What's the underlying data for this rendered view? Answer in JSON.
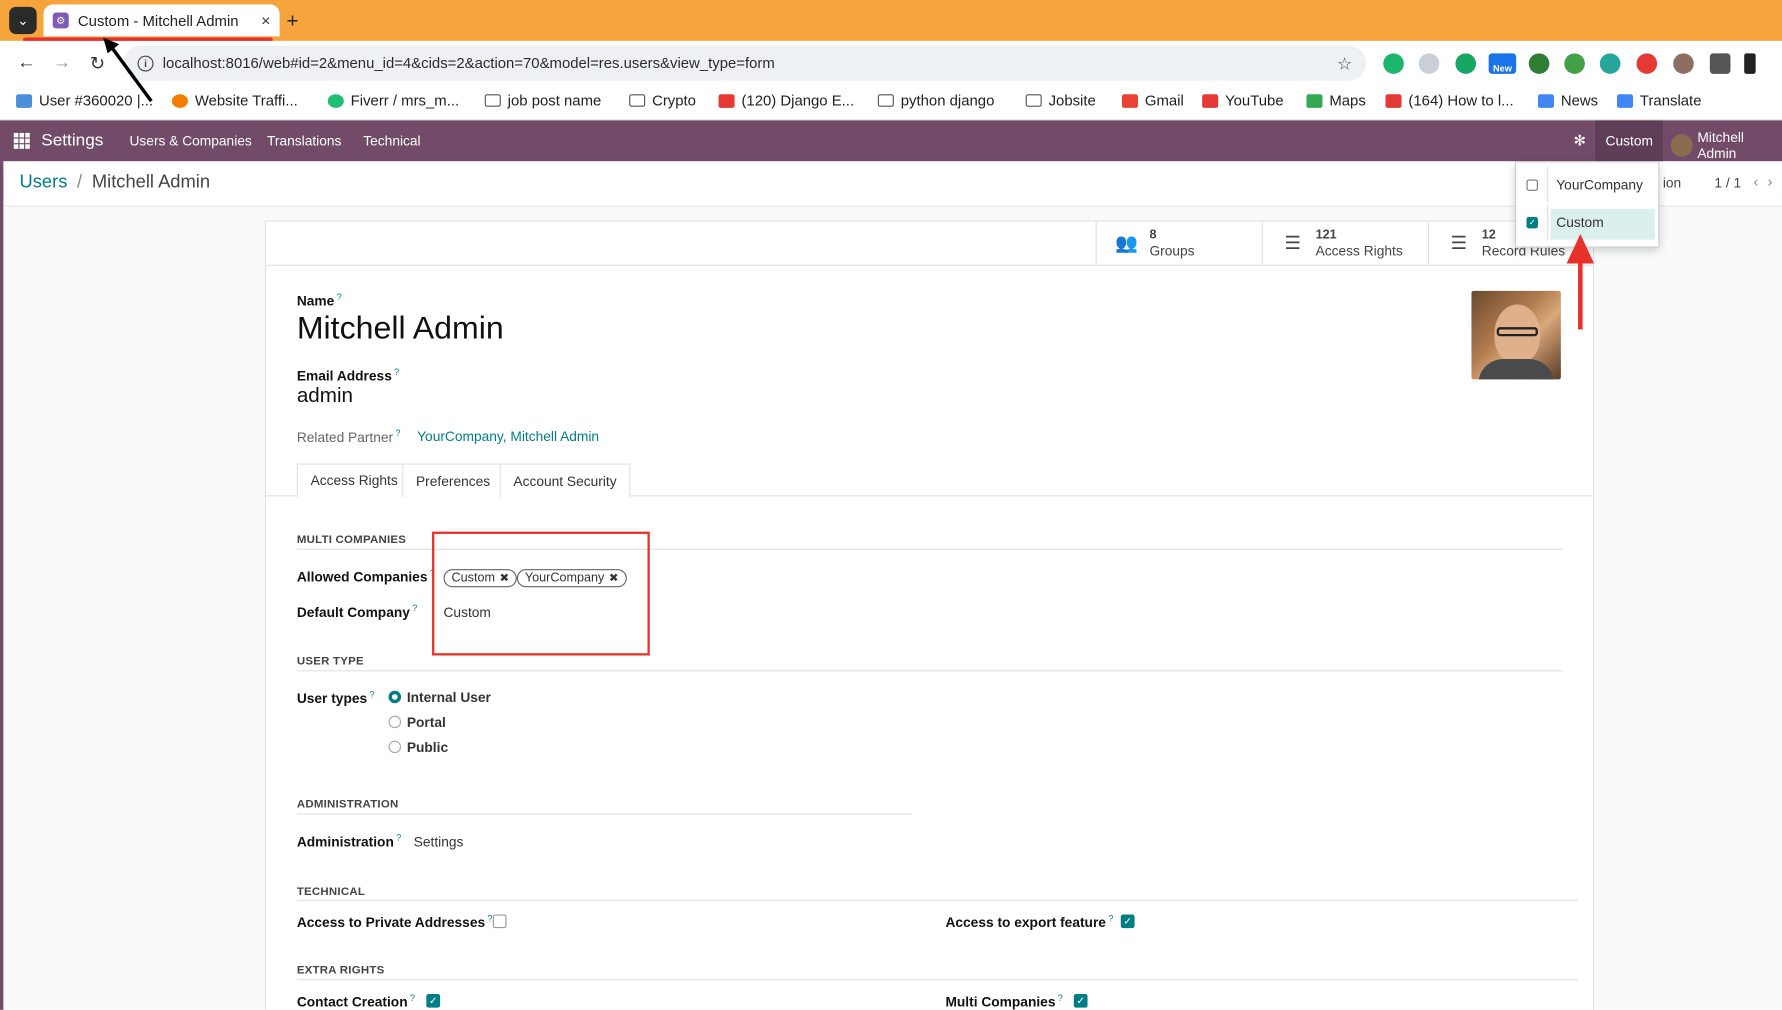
{
  "browser": {
    "tab_title": "Custom - Mitchell Admin",
    "new_tab": "+",
    "close_tab": "×",
    "url": "localhost:8016/web#id=2&menu_id=4&cids=2&action=70&model=res.users&view_type=form",
    "bookmarks": [
      "User #360020 |...",
      "Website Traffi...",
      "Fiverr / mrs_m...",
      "job post name",
      "Crypto",
      "(120) Django E...",
      "python django",
      "Jobsite",
      "Gmail",
      "YouTube",
      "Maps",
      "(164) How to l...",
      "News",
      "Translate"
    ],
    "extension_badge": "New"
  },
  "odoo_nav": {
    "brand": "Settings",
    "menus": [
      "Users & Companies",
      "Translations",
      "Technical"
    ],
    "company": "Custom",
    "user": "Mitchell Admin"
  },
  "company_switcher": {
    "items": [
      {
        "label": "YourCompany",
        "checked": false
      },
      {
        "label": "Custom",
        "checked": true
      }
    ]
  },
  "breadcrumb": {
    "parent": "Users",
    "separator": "/",
    "current": "Mitchell Admin"
  },
  "pager": {
    "hidden_label": "ion",
    "value": "1 / 1"
  },
  "stat_buttons": [
    {
      "value": "8",
      "label": "Groups"
    },
    {
      "value": "121",
      "label": "Access Rights"
    },
    {
      "value": "12",
      "label": "Record Rules"
    }
  ],
  "form": {
    "name_label": "Name",
    "name": "Mitchell Admin",
    "email_label": "Email Address",
    "email": "admin",
    "partner_label": "Related Partner",
    "partner": "YourCompany, Mitchell Admin",
    "help_mark": "?"
  },
  "notebook_tabs": [
    "Access Rights",
    "Preferences",
    "Account Security"
  ],
  "multi_companies": {
    "section": "MULTI COMPANIES",
    "allowed_label": "Allowed Companies",
    "allowed_tags": [
      "Custom",
      "YourCompany"
    ],
    "default_label": "Default Company",
    "default_value": "Custom"
  },
  "user_type": {
    "section": "USER TYPE",
    "label": "User types",
    "options": [
      {
        "label": "Internal User",
        "selected": true
      },
      {
        "label": "Portal",
        "selected": false
      },
      {
        "label": "Public",
        "selected": false
      }
    ]
  },
  "administration": {
    "section": "ADMINISTRATION",
    "label": "Administration",
    "value": "Settings"
  },
  "technical": {
    "section": "TECHNICAL",
    "private_addresses_label": "Access to Private Addresses",
    "private_addresses": false,
    "export_label": "Access to export feature",
    "export": true
  },
  "extra_rights": {
    "section": "EXTRA RIGHTS",
    "contact_creation_label": "Contact Creation",
    "contact_creation": true,
    "multi_companies_label": "Multi Companies",
    "multi_companies": true
  },
  "colors": {
    "odoo_primary": "#714b67",
    "accent_teal": "#017e84",
    "annotation_red": "#e8312a",
    "browser_frame": "#f6a43c"
  }
}
